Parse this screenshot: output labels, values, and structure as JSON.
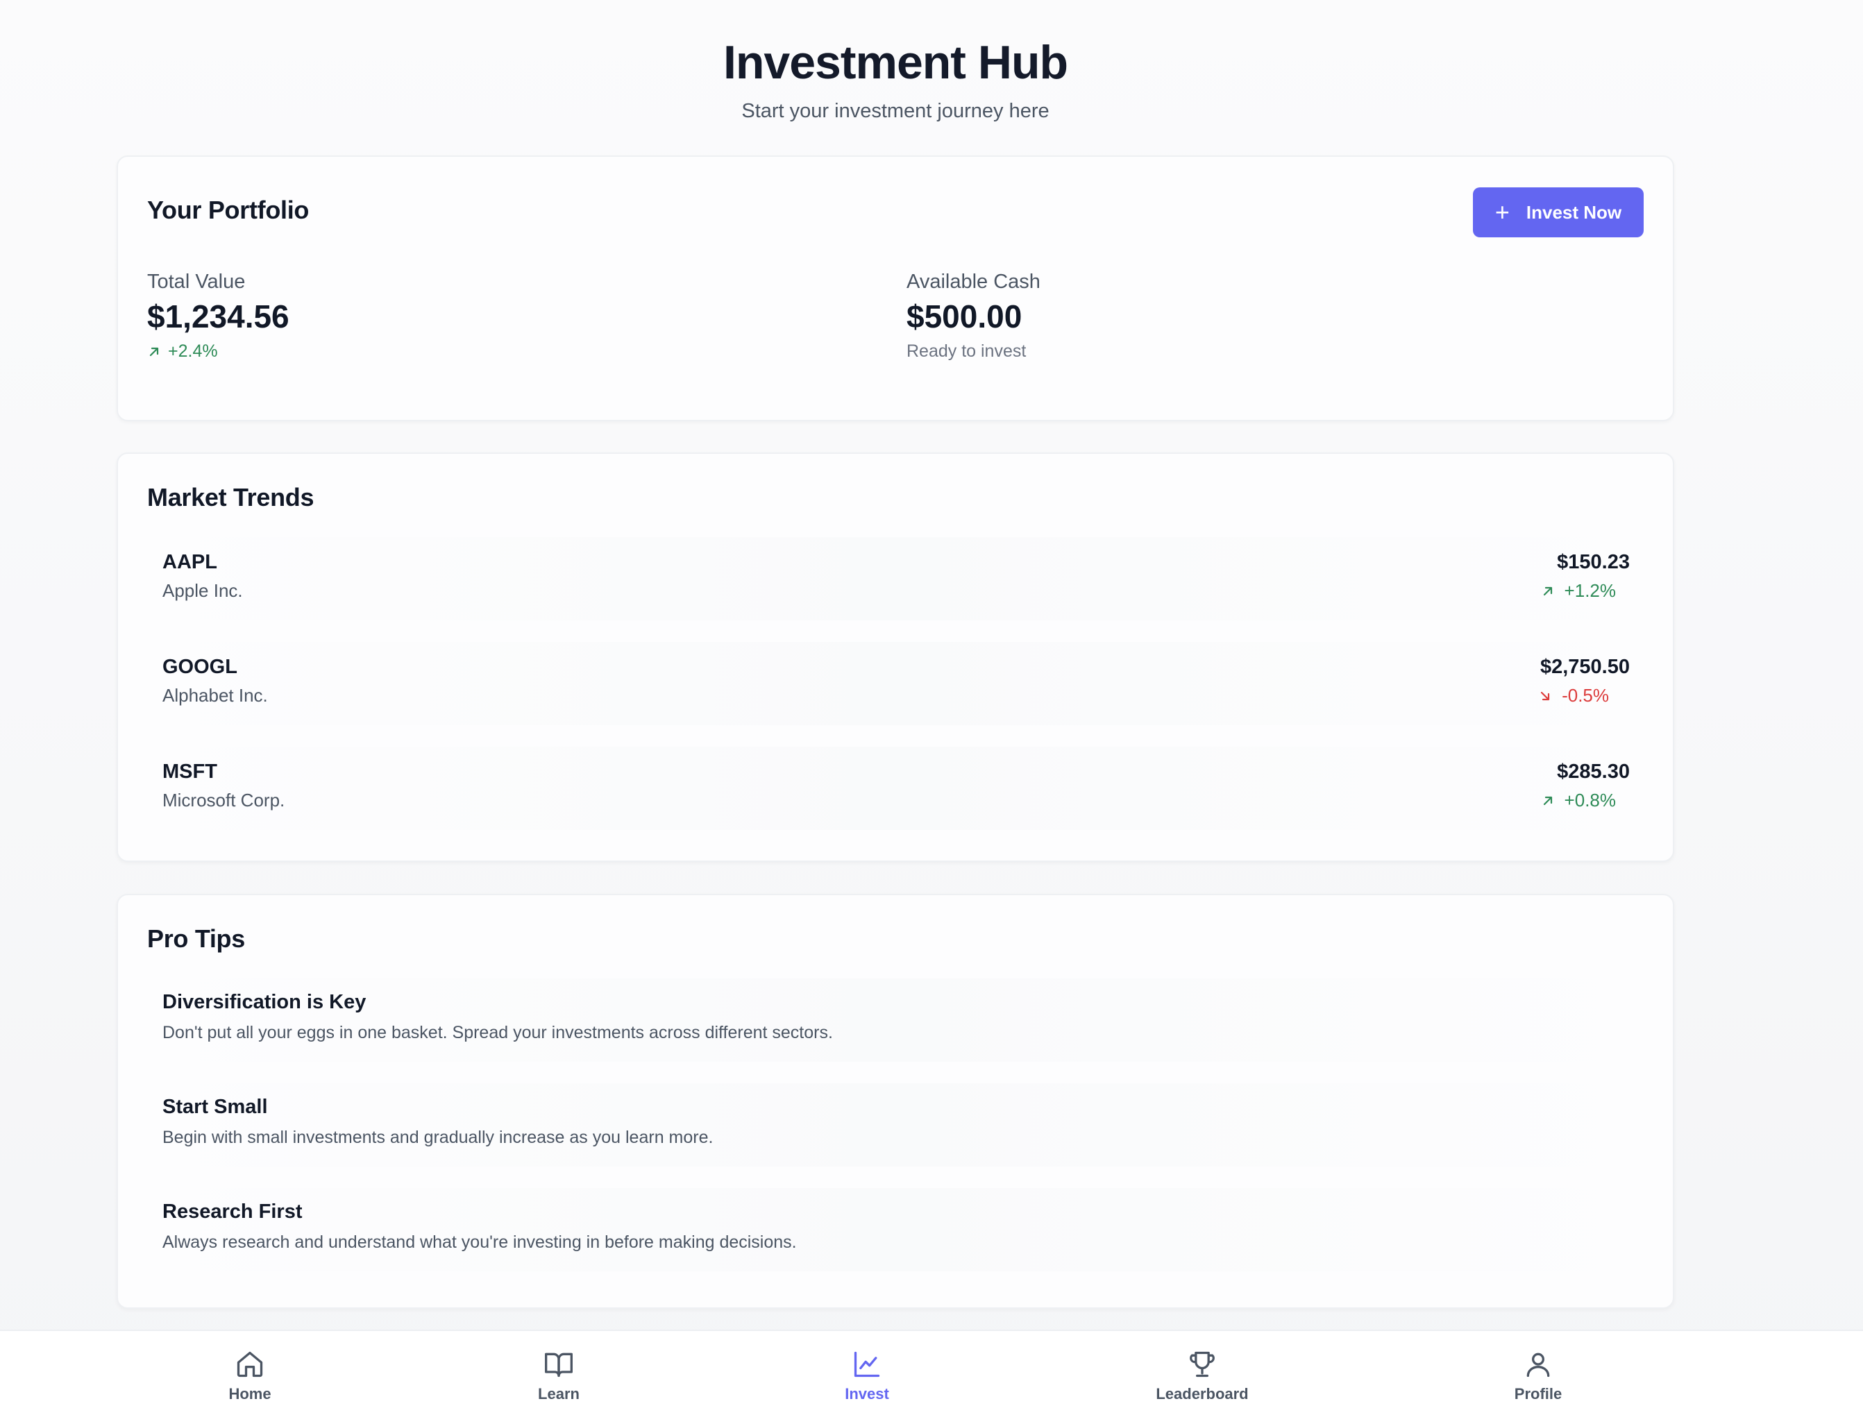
{
  "header": {
    "title": "Investment Hub",
    "subtitle": "Start your investment journey here"
  },
  "portfolio": {
    "title": "Your Portfolio",
    "invest_button": "Invest Now",
    "total_value": {
      "label": "Total Value",
      "value": "$1,234.56",
      "change": "+2.4%"
    },
    "available_cash": {
      "label": "Available Cash",
      "value": "$500.00",
      "note": "Ready to invest"
    }
  },
  "market": {
    "title": "Market Trends",
    "stocks": [
      {
        "symbol": "AAPL",
        "name": "Apple Inc.",
        "price": "$150.23",
        "change": "+1.2%",
        "direction": "up"
      },
      {
        "symbol": "GOOGL",
        "name": "Alphabet Inc.",
        "price": "$2,750.50",
        "change": "-0.5%",
        "direction": "down"
      },
      {
        "symbol": "MSFT",
        "name": "Microsoft Corp.",
        "price": "$285.30",
        "change": "+0.8%",
        "direction": "up"
      }
    ]
  },
  "tips": {
    "title": "Pro Tips",
    "items": [
      {
        "title": "Diversification is Key",
        "description": "Don't put all your eggs in one basket. Spread your investments across different sectors."
      },
      {
        "title": "Start Small",
        "description": "Begin with small investments and gradually increase as you learn more."
      },
      {
        "title": "Research First",
        "description": "Always research and understand what you're investing in before making decisions."
      }
    ]
  },
  "nav": {
    "items": [
      {
        "label": "Home",
        "icon": "home-icon"
      },
      {
        "label": "Learn",
        "icon": "book-icon"
      },
      {
        "label": "Invest",
        "icon": "chart-icon",
        "active": true
      },
      {
        "label": "Leaderboard",
        "icon": "trophy-icon"
      },
      {
        "label": "Profile",
        "icon": "user-icon"
      }
    ]
  },
  "colors": {
    "accent": "#6366f1",
    "positive": "#2e8b57",
    "negative": "#dc3c3c"
  }
}
